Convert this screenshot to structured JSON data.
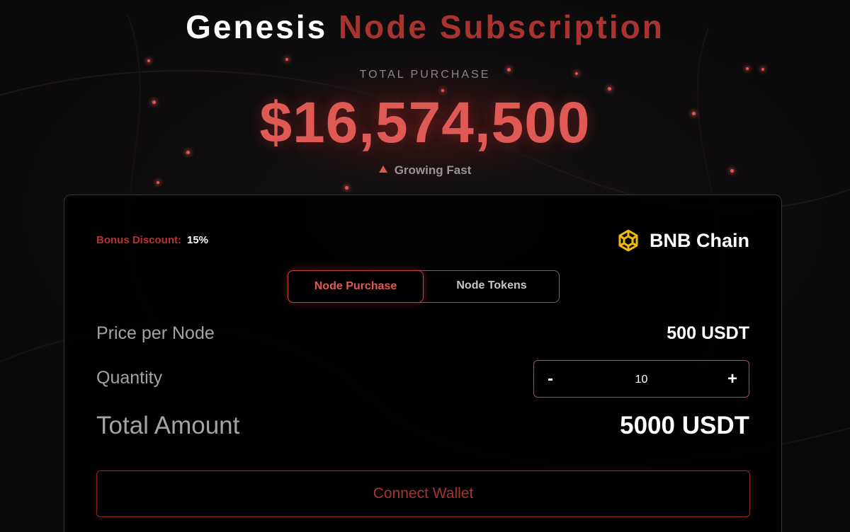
{
  "header": {
    "title_part1": "Genesis",
    "title_part2": "Node Subscription"
  },
  "stats": {
    "label": "TOTAL PURCHASE",
    "value": "$16,574,500",
    "trend": "Growing Fast",
    "trend_icon": "triangle-up-icon"
  },
  "card": {
    "bonus_label": "Bonus Discount:",
    "bonus_value": "15%",
    "chain_name": "BNB Chain",
    "chain_icon": "bnb-chain-logo",
    "tabs": [
      {
        "label": "Node Purchase",
        "active": true
      },
      {
        "label": "Node Tokens",
        "active": false
      }
    ],
    "price_label": "Price per Node",
    "price_value": "500 USDT",
    "quantity_label": "Quantity",
    "quantity": {
      "minus": "-",
      "value": "10",
      "plus": "+"
    },
    "total_label": "Total Amount",
    "total_value": "5000 USDT",
    "connect_label": "Connect Wallet"
  },
  "colors": {
    "accent": "#e05a55",
    "accent_dark": "#a8332f",
    "bnb_yellow": "#f0b90b",
    "background": "#0b0a0b"
  }
}
